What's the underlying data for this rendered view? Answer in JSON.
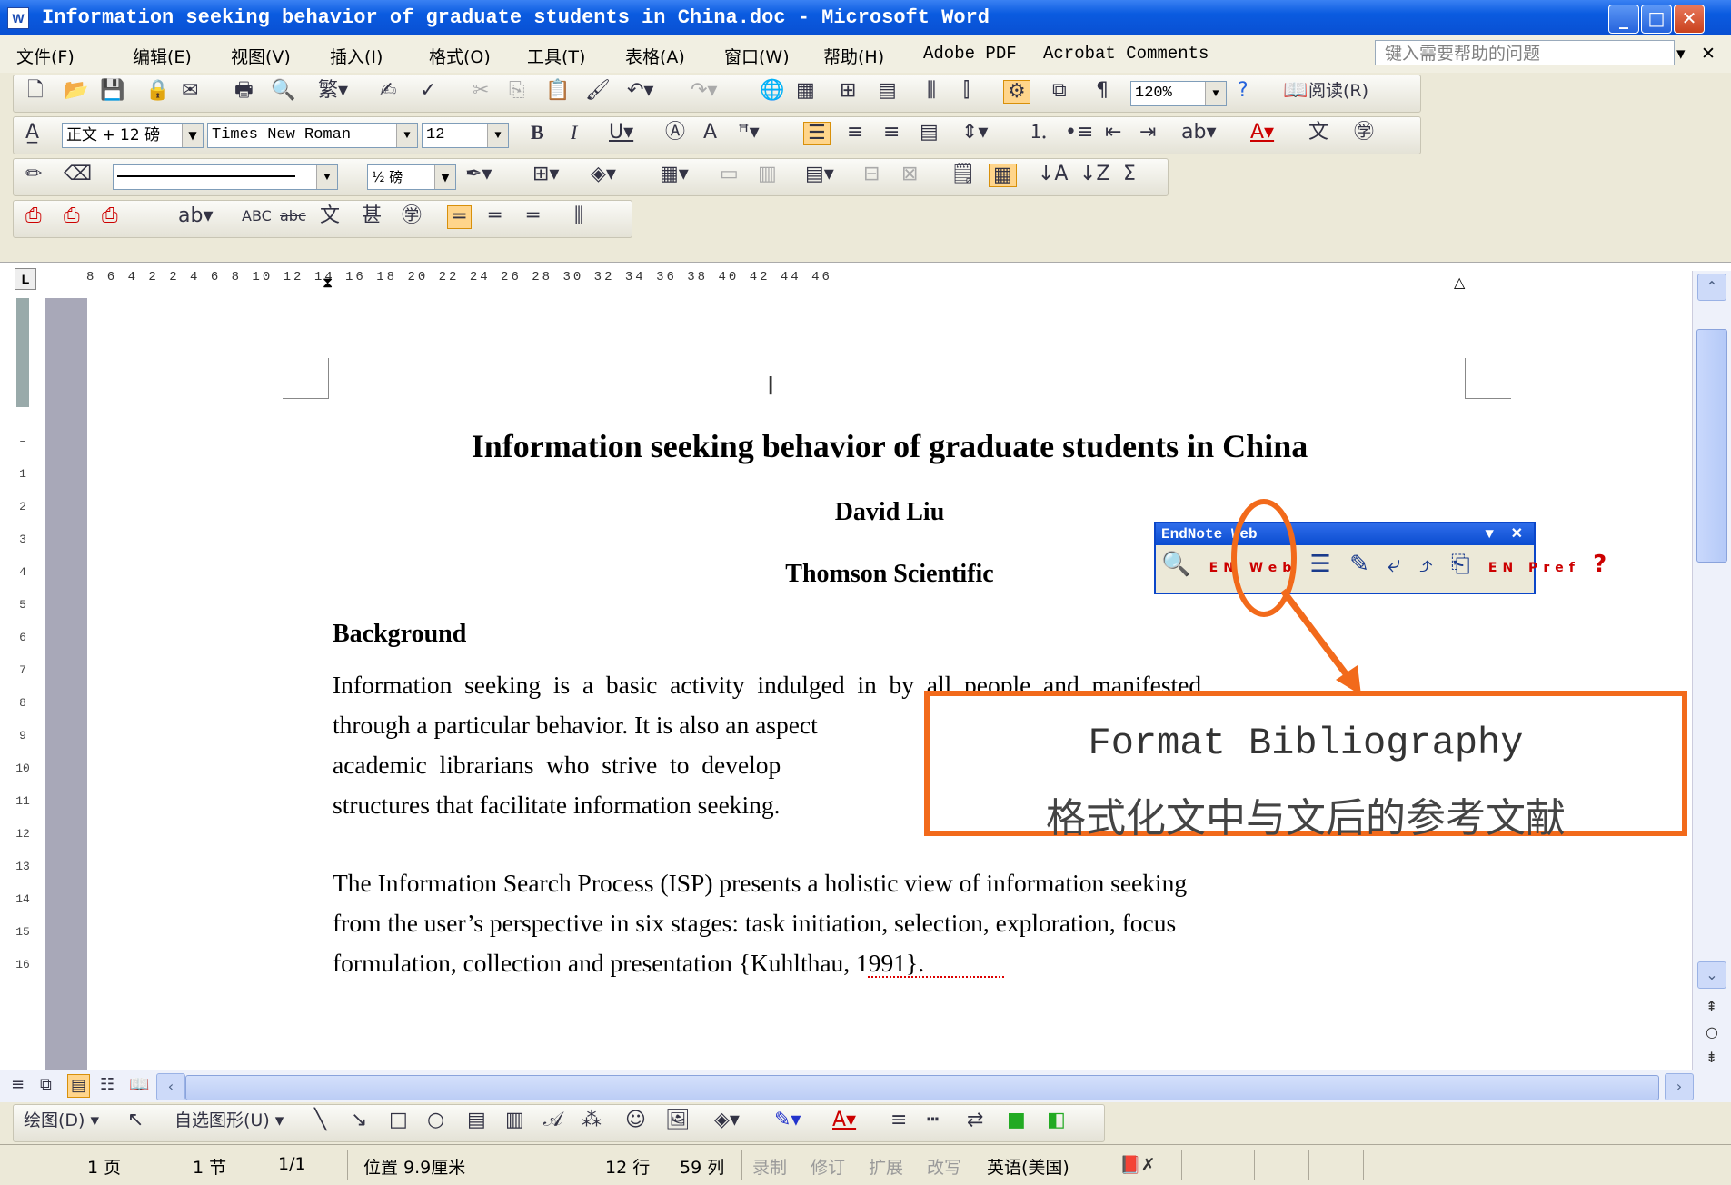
{
  "window": {
    "title": "Information seeking behavior of graduate students in China.doc - Microsoft Word",
    "app_icon": "word-icon"
  },
  "menu": {
    "items": [
      "文件(F)",
      "编辑(E)",
      "视图(V)",
      "插入(I)",
      "格式(O)",
      "工具(T)",
      "表格(A)",
      "窗口(W)",
      "帮助(H)",
      "Adobe PDF",
      "Acrobat Comments"
    ],
    "help_placeholder": "键入需要帮助的问题"
  },
  "toolbars": {
    "zoom": "120%",
    "read_label": "阅读(R)",
    "style": "正文 + 12 磅",
    "font": "Times New Roman",
    "size": "12",
    "line_weight": "½ 磅"
  },
  "ruler": {
    "numbers": "8  6  4  2     2  4  6  8  10  12  14  16  18  20  22  24  26  28  30  32  34  36  38  40  42  44  46",
    "corner": "L"
  },
  "document": {
    "title": "Information seeking behavior of graduate students in China",
    "author": "David Liu",
    "affiliation": "Thomson Scientific",
    "heading": "Background",
    "para1_lines": [
      "Information  seeking  is  a  basic  activity  indulged  in  by  all  people  and  manifested",
      "through a particular behavior. It is also an aspect",
      "academic  librarians  who  strive  to  develop",
      "structures that facilitate information seeking."
    ],
    "para2_lines": [
      "The Information Search Process (ISP) presents a holistic view of information seeking",
      "from the user’s perspective in six stages: task initiation, selection, exploration, focus",
      "formulation, collection and presentation {Kuhlthau, 1991}."
    ]
  },
  "endnote_toolbar": {
    "title": "EndNote Web",
    "pref_label": "EN Pref",
    "web_label": "EN Web"
  },
  "callout": {
    "line1": "Format Bibliography",
    "line2": "格式化文中与文后的参考文献",
    "color": "#F26A1B"
  },
  "draw_toolbar": {
    "draw_label": "绘图(D)",
    "autoshape_label": "自选图形(U)"
  },
  "status": {
    "page": "1 页",
    "section": "1 节",
    "pages": "1/1",
    "position": "位置 9.9厘米",
    "line": "12 行",
    "column": "59 列",
    "rec": "录制",
    "trk": "修订",
    "ext": "扩展",
    "ovr": "改写",
    "language": "英语(美国)"
  }
}
